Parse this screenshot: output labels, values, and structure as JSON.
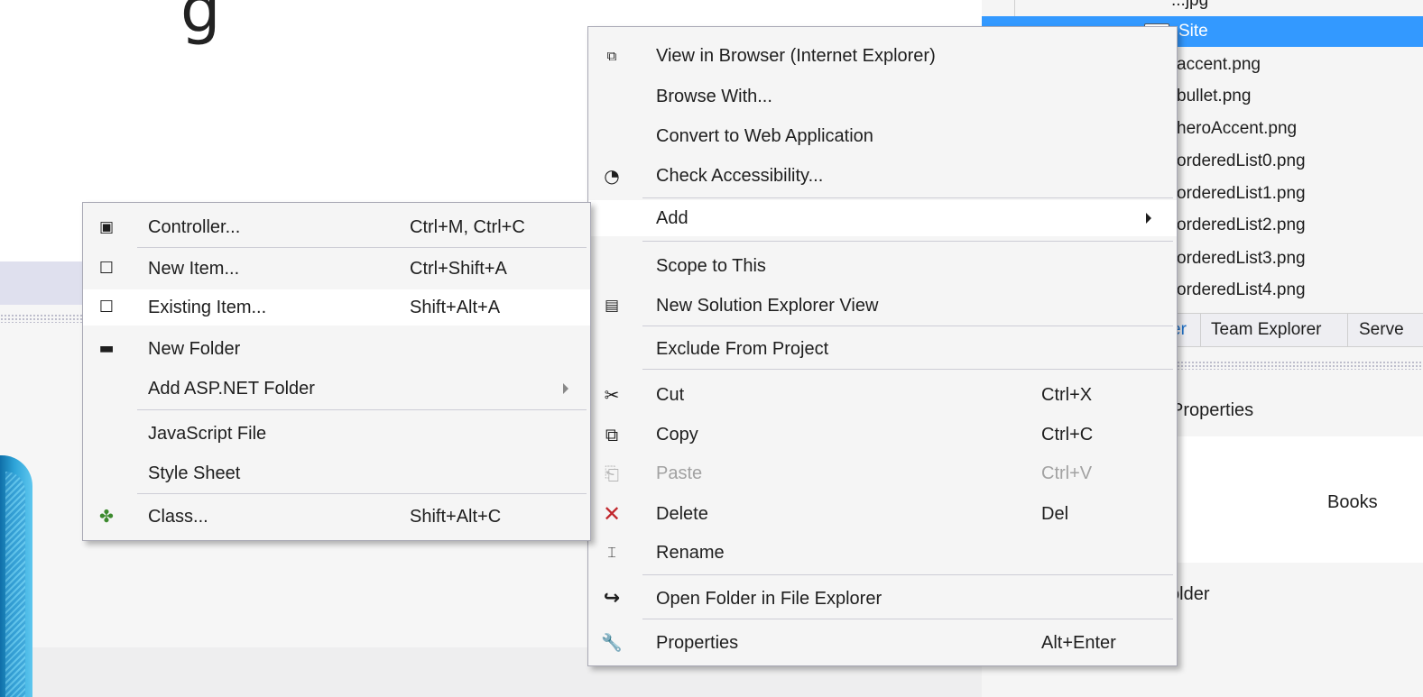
{
  "slide_glyph": "g",
  "solution_explorer": {
    "partial_item": "...jpg",
    "items": [
      {
        "label": "Site",
        "selected": true
      },
      {
        "label": "accent.png"
      },
      {
        "label": "bullet.png"
      },
      {
        "label": "heroAccent.png"
      },
      {
        "label": "orderedList0.png"
      },
      {
        "label": "orderedList1.png"
      },
      {
        "label": "orderedList2.png"
      },
      {
        "label": "orderedList3.png"
      },
      {
        "label": "orderedList4.png"
      }
    ],
    "tabs": [
      {
        "label": "er",
        "active": true
      },
      {
        "label": "Team Explorer"
      },
      {
        "label": "Serve"
      }
    ],
    "properties_title": "Properties",
    "property_value": "Books",
    "property_name_fragment": "e",
    "folder_fragment": "older"
  },
  "context_menu": {
    "items": [
      {
        "label": "View in Browser (Internet Explorer)",
        "icon": "browser-icon"
      },
      {
        "label": "Browse With..."
      },
      {
        "label": "Convert to Web Application"
      },
      {
        "label": "Check Accessibility...",
        "icon": "accessibility-icon"
      },
      {
        "label": "Add",
        "submenu": true
      },
      {
        "label": "Scope to This"
      },
      {
        "label": "New Solution Explorer View",
        "icon": "new-view-icon"
      },
      {
        "label": "Exclude From Project"
      },
      {
        "label": "Cut",
        "shortcut": "Ctrl+X",
        "icon": "scissors-icon"
      },
      {
        "label": "Copy",
        "shortcut": "Ctrl+C",
        "icon": "copy-icon"
      },
      {
        "label": "Paste",
        "shortcut": "Ctrl+V",
        "icon": "paste-icon",
        "disabled": true
      },
      {
        "label": "Delete",
        "shortcut": "Del",
        "icon": "delete-icon",
        "icon_color": "#c1272d"
      },
      {
        "label": "Rename",
        "icon": "rename-icon"
      },
      {
        "label": "Open Folder in File Explorer",
        "icon": "open-folder-arrow-icon"
      },
      {
        "label": "Properties",
        "shortcut": "Alt+Enter",
        "icon": "wrench-icon"
      }
    ]
  },
  "add_submenu": {
    "items": [
      {
        "label": "Controller...",
        "shortcut": "Ctrl+M, Ctrl+C",
        "icon": "controller-icon"
      },
      {
        "label": "New Item...",
        "shortcut": "Ctrl+Shift+A",
        "icon": "new-item-icon"
      },
      {
        "label": "Existing Item...",
        "shortcut": "Shift+Alt+A",
        "icon": "existing-item-icon",
        "highlighted": true
      },
      {
        "label": "New Folder",
        "icon": "new-folder-icon"
      },
      {
        "label": "Add ASP.NET Folder",
        "submenu": true
      },
      {
        "label": "JavaScript File"
      },
      {
        "label": "Style Sheet"
      },
      {
        "label": "Class...",
        "shortcut": "Shift+Alt+C",
        "icon": "class-icon",
        "icon_color": "#3c8a2e"
      }
    ]
  },
  "colors": {
    "selection": "#3399ff",
    "menu_background": "#f5f5f5",
    "highlight": "#ffffff",
    "accent_blue": "#1e70c8"
  }
}
